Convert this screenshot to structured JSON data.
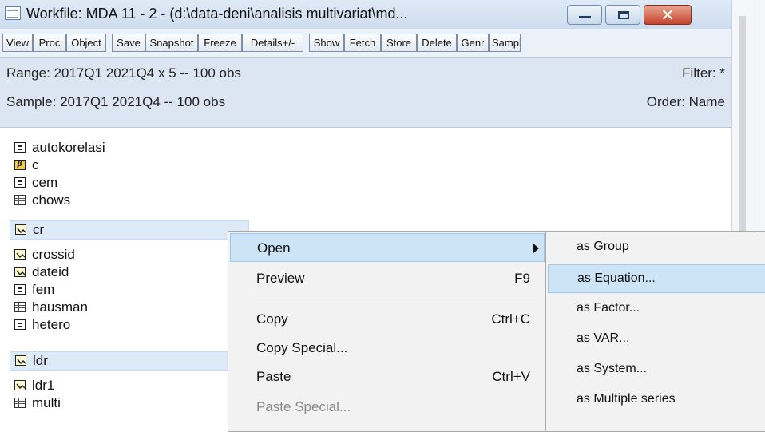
{
  "window": {
    "title": "Workfile: MDA 11 - 2 - (d:\\data-deni\\analisis multivariat\\md...",
    "close_glyph": "✕"
  },
  "toolbar": {
    "buttons": [
      "View",
      "Proc",
      "Object",
      "Save",
      "Snapshot",
      "Freeze",
      "Details+/-",
      "Show",
      "Fetch",
      "Store",
      "Delete",
      "Genr",
      "Sampl"
    ]
  },
  "info": {
    "range": "Range:  2017Q1 2021Q4 x 5  --  100 obs",
    "filter": "Filter: *",
    "sample": "Sample: 2017Q1 2021Q4  --  100 obs",
    "order": "Order: Name"
  },
  "objects": [
    {
      "name": "autokorelasi",
      "icon": "equation-icon"
    },
    {
      "name": "c",
      "icon": "coefficient-icon"
    },
    {
      "name": "cem",
      "icon": "equation-icon"
    },
    {
      "name": "chows",
      "icon": "table-icon"
    },
    {
      "name": "cr",
      "icon": "series-icon",
      "selected": true
    },
    {
      "name": "crossid",
      "icon": "series-icon"
    },
    {
      "name": "dateid",
      "icon": "series-icon"
    },
    {
      "name": "fem",
      "icon": "equation-icon"
    },
    {
      "name": "hausman",
      "icon": "table-icon"
    },
    {
      "name": "hetero",
      "icon": "equation-icon"
    },
    {
      "name": "ldr",
      "icon": "series-icon",
      "selected": true
    },
    {
      "name": "ldr1",
      "icon": "series-icon"
    },
    {
      "name": "multi",
      "icon": "table-icon"
    }
  ],
  "coef_glyph": "β",
  "context_menu": {
    "open": "Open",
    "preview": "Preview",
    "preview_key": "F9",
    "copy": "Copy",
    "copy_key": "Ctrl+C",
    "copy_special": "Copy Special...",
    "paste": "Paste",
    "paste_key": "Ctrl+V",
    "paste_special": "Paste Special..."
  },
  "submenu": {
    "items": [
      "as Group",
      "as Equation...",
      "as Factor...",
      "as VAR...",
      "as System...",
      "as Multiple series"
    ]
  },
  "colors": {
    "highlight": "#cde4f7",
    "info_bg": "#dbe6f2",
    "close_red": "#c6432b"
  }
}
